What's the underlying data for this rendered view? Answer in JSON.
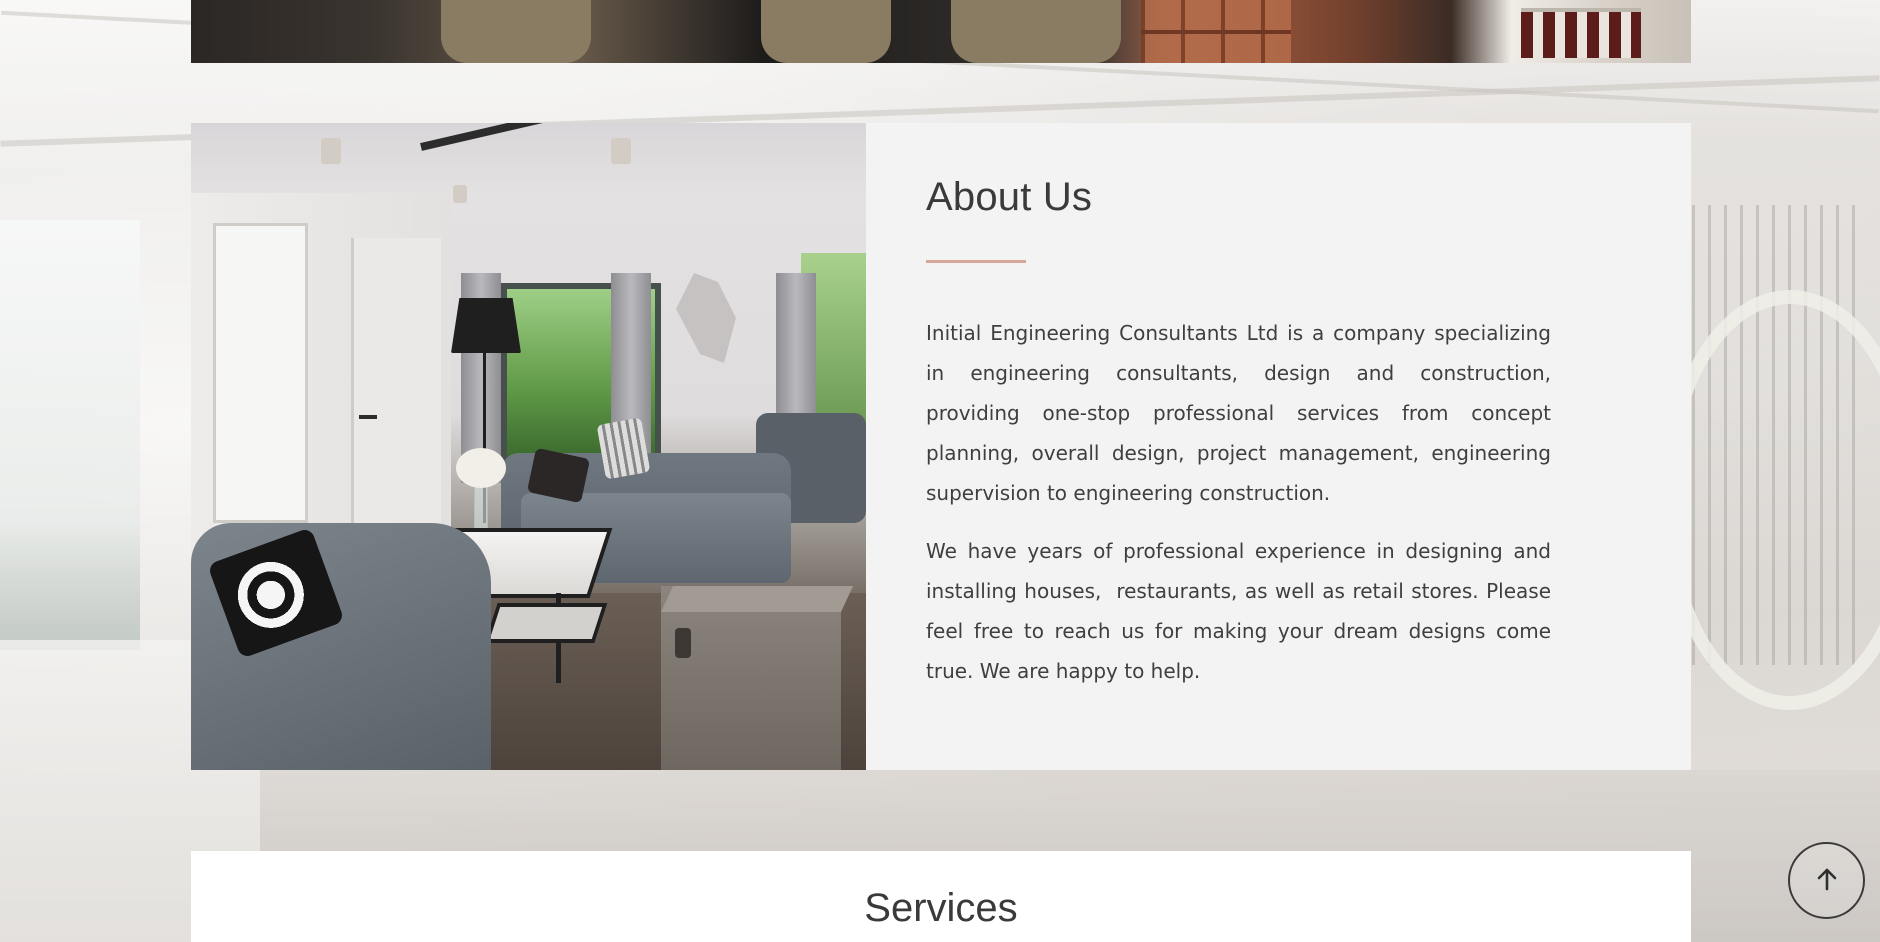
{
  "about": {
    "title": "About Us",
    "paragraphs": [
      "Initial Engineering Consultants Ltd is a company specializing in engineering consultants, design and construction, providing one-stop professional services from concept planning, overall design, project management, engineering supervision to engineering construction.",
      "We have years of professional experience in designing and installing houses,  restaurants, as well as retail stores. Please feel free to reach us for making your dream designs come true. We are happy to help."
    ],
    "accent_color": "#d7a89a"
  },
  "services": {
    "title": "Services"
  },
  "back_to_top": {
    "icon": "arrow-up-icon"
  },
  "colors": {
    "text": "#3a3a3a",
    "panel": "#f3f3f3"
  }
}
